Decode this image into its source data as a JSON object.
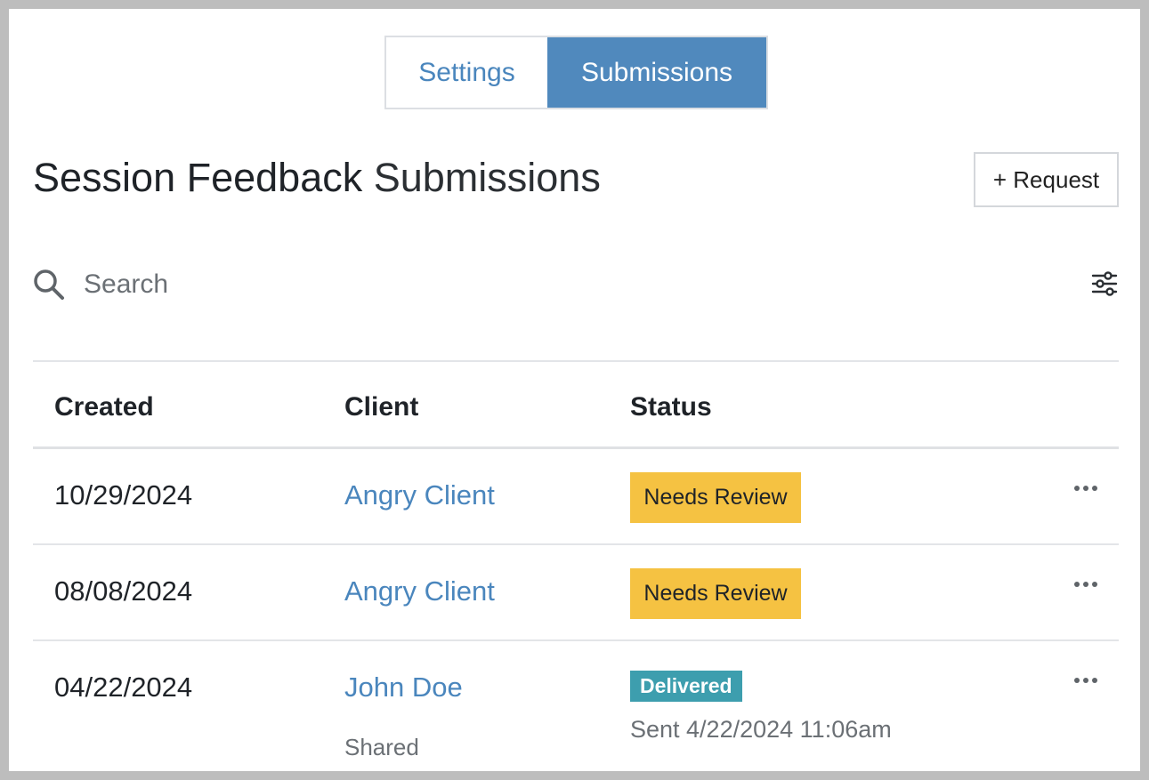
{
  "tabs": [
    {
      "label": "Settings",
      "active": false
    },
    {
      "label": "Submissions",
      "active": true
    }
  ],
  "header": {
    "title_strong": "Session Feedback",
    "title_light": "Submissions",
    "request_label": "+ Request"
  },
  "search": {
    "placeholder": "Search",
    "value": ""
  },
  "icons": {
    "search": "search-icon",
    "filter": "sliders-icon",
    "more": "more-horizontal-icon"
  },
  "table": {
    "columns": [
      "Created",
      "Client",
      "Status"
    ],
    "rows": [
      {
        "created": "10/29/2024",
        "client": "Angry Client",
        "status": "Needs Review"
      },
      {
        "created": "08/08/2024",
        "client": "Angry Client",
        "status": "Needs Review"
      },
      {
        "created": "04/22/2024",
        "client": "John Doe",
        "client_note": "Shared",
        "status": "Delivered",
        "status_note": "Sent 4/22/2024 11:06am"
      }
    ]
  },
  "colors": {
    "accent": "#5089bd",
    "link": "#4a86bd",
    "needs_review": "#f5c242",
    "delivered": "#3d9eae"
  }
}
